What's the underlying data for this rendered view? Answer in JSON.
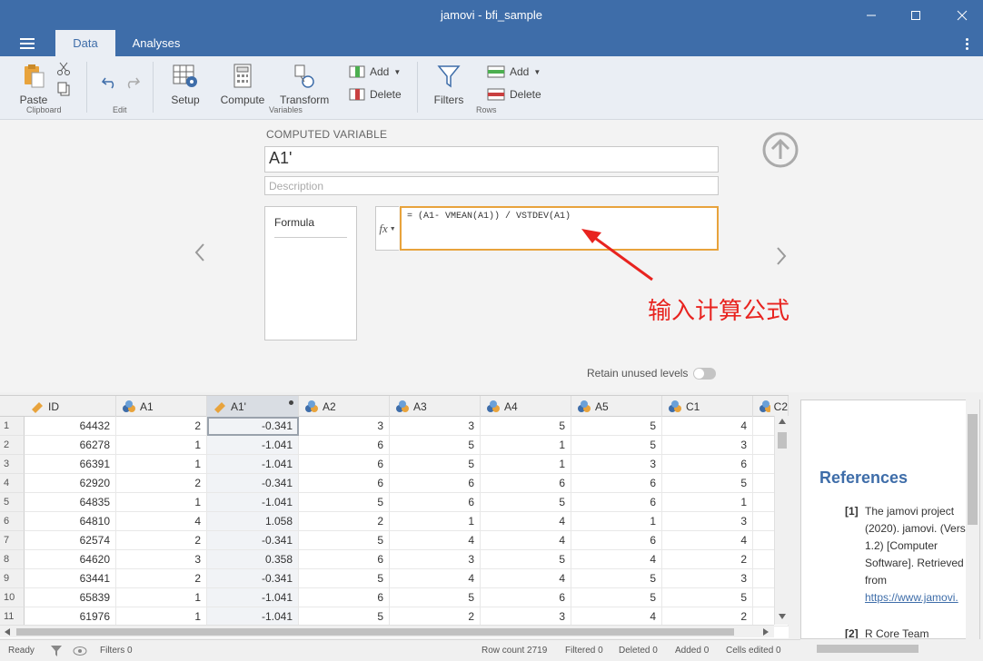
{
  "window": {
    "title": "jamovi - bfi_sample",
    "minimize": "—",
    "maximize": "☐",
    "close": "✕"
  },
  "tabs": [
    {
      "label": "Data",
      "active": true
    },
    {
      "label": "Analyses",
      "active": false
    }
  ],
  "ribbon": {
    "clipboard": {
      "paste": "Paste",
      "group": "Clipboard"
    },
    "edit": {
      "group": "Edit"
    },
    "variables": {
      "setup": "Setup",
      "compute": "Compute",
      "transform": "Transform",
      "add": "Add",
      "delete": "Delete",
      "group": "Variables"
    },
    "rows": {
      "filters": "Filters",
      "add": "Add",
      "delete": "Delete",
      "group": "Rows"
    }
  },
  "compute_panel": {
    "section_label": "COMPUTED VARIABLE",
    "variable_name": "A1'",
    "description_placeholder": "Description",
    "formula_tab": "Formula",
    "fx_label": "fx",
    "formula": "= (A1- VMEAN(A1)) / VSTDEV(A1)",
    "annotation": "输入计算公式",
    "retain_unused_levels": "Retain unused levels"
  },
  "sheet": {
    "columns": [
      "ID",
      "A1",
      "A1'",
      "A2",
      "A3",
      "A4",
      "A5",
      "C1",
      "C2"
    ],
    "rows": [
      {
        "n": "1",
        "cells": [
          "64432",
          "2",
          "-0.341",
          "3",
          "3",
          "5",
          "5",
          "4"
        ]
      },
      {
        "n": "2",
        "cells": [
          "66278",
          "1",
          "-1.041",
          "6",
          "5",
          "1",
          "5",
          "3"
        ]
      },
      {
        "n": "3",
        "cells": [
          "66391",
          "1",
          "-1.041",
          "6",
          "5",
          "1",
          "3",
          "6"
        ]
      },
      {
        "n": "4",
        "cells": [
          "62920",
          "2",
          "-0.341",
          "6",
          "6",
          "6",
          "6",
          "5"
        ]
      },
      {
        "n": "5",
        "cells": [
          "64835",
          "1",
          "-1.041",
          "5",
          "6",
          "5",
          "6",
          "1"
        ]
      },
      {
        "n": "6",
        "cells": [
          "64810",
          "4",
          "1.058",
          "2",
          "1",
          "4",
          "1",
          "3"
        ]
      },
      {
        "n": "7",
        "cells": [
          "62574",
          "2",
          "-0.341",
          "5",
          "4",
          "4",
          "6",
          "4"
        ]
      },
      {
        "n": "8",
        "cells": [
          "64620",
          "3",
          "0.358",
          "6",
          "3",
          "5",
          "4",
          "2"
        ]
      },
      {
        "n": "9",
        "cells": [
          "63441",
          "2",
          "-0.341",
          "5",
          "4",
          "4",
          "5",
          "3"
        ]
      },
      {
        "n": "10",
        "cells": [
          "65839",
          "1",
          "-1.041",
          "6",
          "5",
          "6",
          "5",
          "5"
        ]
      },
      {
        "n": "11",
        "cells": [
          "61976",
          "1",
          "-1.041",
          "5",
          "2",
          "3",
          "4",
          "2"
        ]
      }
    ]
  },
  "results": {
    "title": "References",
    "refs": [
      {
        "num": "[1]",
        "lines": [
          "The jamovi project",
          "(2020). jamovi. (Vers",
          "1.2) [Computer",
          "Software]. Retrieved",
          "from"
        ],
        "link": "https://www.jamovi."
      },
      {
        "num": "[2]",
        "lines": [
          "R Core Team"
        ]
      }
    ]
  },
  "status": {
    "ready": "Ready",
    "filters": "Filters 0",
    "row_count": "Row count 2719",
    "filtered": "Filtered 0",
    "deleted": "Deleted 0",
    "added": "Added 0",
    "cells_edited": "Cells edited 0"
  },
  "colors": {
    "titlebar": "#3e6da9",
    "formula_border": "#e8a33c",
    "annotation": "#e8231f",
    "ruler_icon": "#e8a33c"
  }
}
